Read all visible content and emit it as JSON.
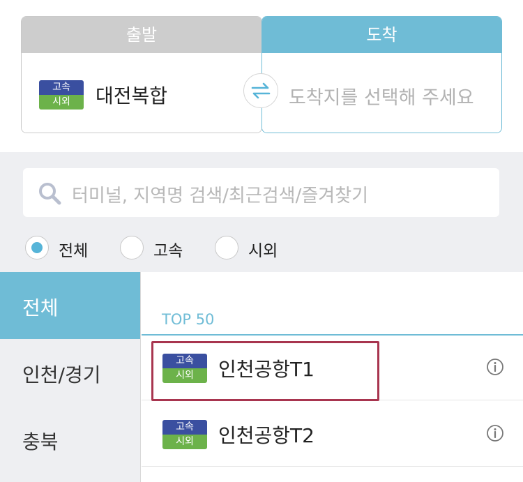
{
  "departure": {
    "header": "출발",
    "badge_top": "고속",
    "badge_bottom": "시외",
    "terminal": "대전복합"
  },
  "arrival": {
    "header": "도착",
    "placeholder": "도착지를 선택해 주세요"
  },
  "search": {
    "placeholder": "터미널, 지역명 검색/최근검색/즐겨찾기"
  },
  "filters": [
    {
      "label": "전체",
      "selected": true
    },
    {
      "label": "고속",
      "selected": false
    },
    {
      "label": "시외",
      "selected": false
    }
  ],
  "regions": [
    "전체",
    "인천/경기",
    "충북"
  ],
  "list": {
    "header": "TOP 50",
    "items": [
      {
        "badge_top": "고속",
        "badge_bottom": "시외",
        "name": "인천공항T1"
      },
      {
        "badge_top": "고속",
        "badge_bottom": "시외",
        "name": "인천공항T2"
      }
    ]
  },
  "colors": {
    "accent": "#6fbcd6",
    "express_badge": "#3a4fa0",
    "intercity_badge": "#6cb24a",
    "highlight": "#a8354f"
  }
}
